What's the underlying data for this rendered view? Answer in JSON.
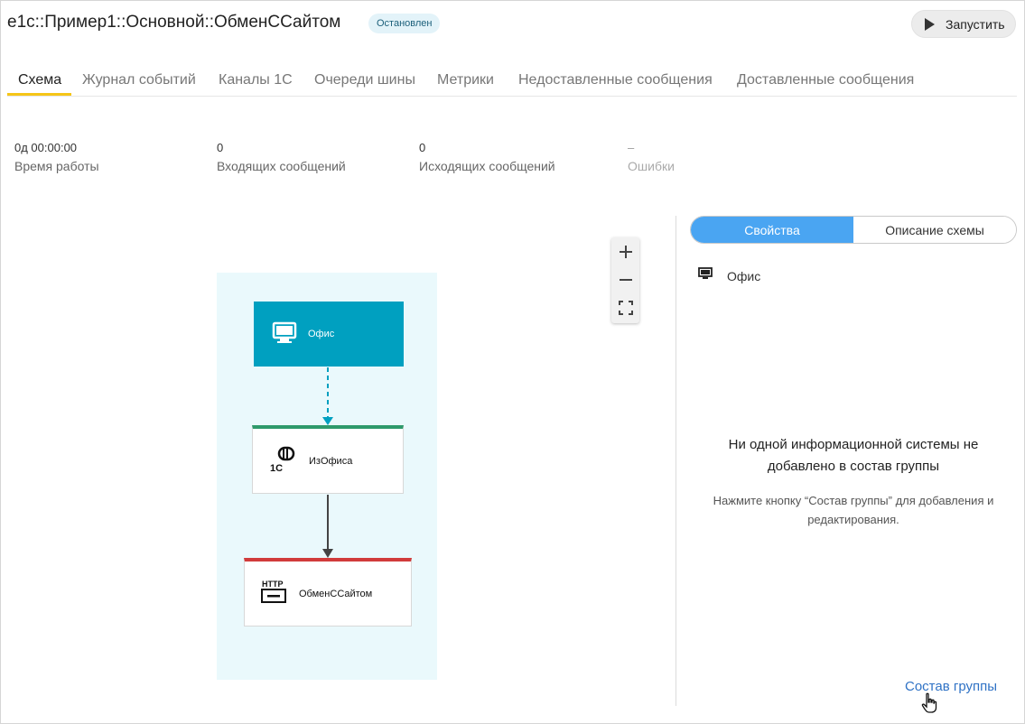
{
  "header": {
    "title": "e1c::Пример1::Основной::ОбменССайтом",
    "status_badge": "Остановлен",
    "run_button": "Запустить"
  },
  "tabs": [
    {
      "label": "Схема",
      "active": true
    },
    {
      "label": "Журнал событий",
      "active": false
    },
    {
      "label": "Каналы 1С",
      "active": false
    },
    {
      "label": "Очереди шины",
      "active": false
    },
    {
      "label": "Метрики",
      "active": false
    },
    {
      "label": "Недоставленные сообщения",
      "active": false
    },
    {
      "label": "Доставленные сообщения",
      "active": false
    }
  ],
  "stats": [
    {
      "value": "0д 00:00:00",
      "label": "Время работы"
    },
    {
      "value": "0",
      "label": "Входящих сообщений"
    },
    {
      "value": "0",
      "label": "Исходящих сообщений"
    },
    {
      "value": "–",
      "label": "Ошибки"
    }
  ],
  "diagram": {
    "nodes": [
      {
        "label": "Офис",
        "icon": "monitor-icon",
        "accent": "#00a0c0"
      },
      {
        "label": "ИзОфиса",
        "icon": "1c-channel-icon",
        "accent": "#2e9a6b"
      },
      {
        "label": "ОбменССайтом",
        "icon": "http-icon",
        "accent": "#d13b3b"
      }
    ],
    "zoom_controls": [
      "zoom-in-icon",
      "zoom-out-icon",
      "fit-screen-icon"
    ]
  },
  "right_panel": {
    "segments": [
      {
        "label": "Свойства",
        "active": true
      },
      {
        "label": "Описание схемы",
        "active": false
      }
    ],
    "selected_item": "Офис",
    "empty_title_lines": [
      "Ни одной информационной системы не",
      "добавлено в состав группы"
    ],
    "empty_hint_lines": [
      "Нажмите кнопку “Состав группы” для добавления и",
      "редактирования."
    ],
    "group_link": "Состав группы"
  },
  "colors": {
    "tab_underline": "#f5c518",
    "segment_active": "#4aa5f2",
    "link": "#2f72c5"
  }
}
